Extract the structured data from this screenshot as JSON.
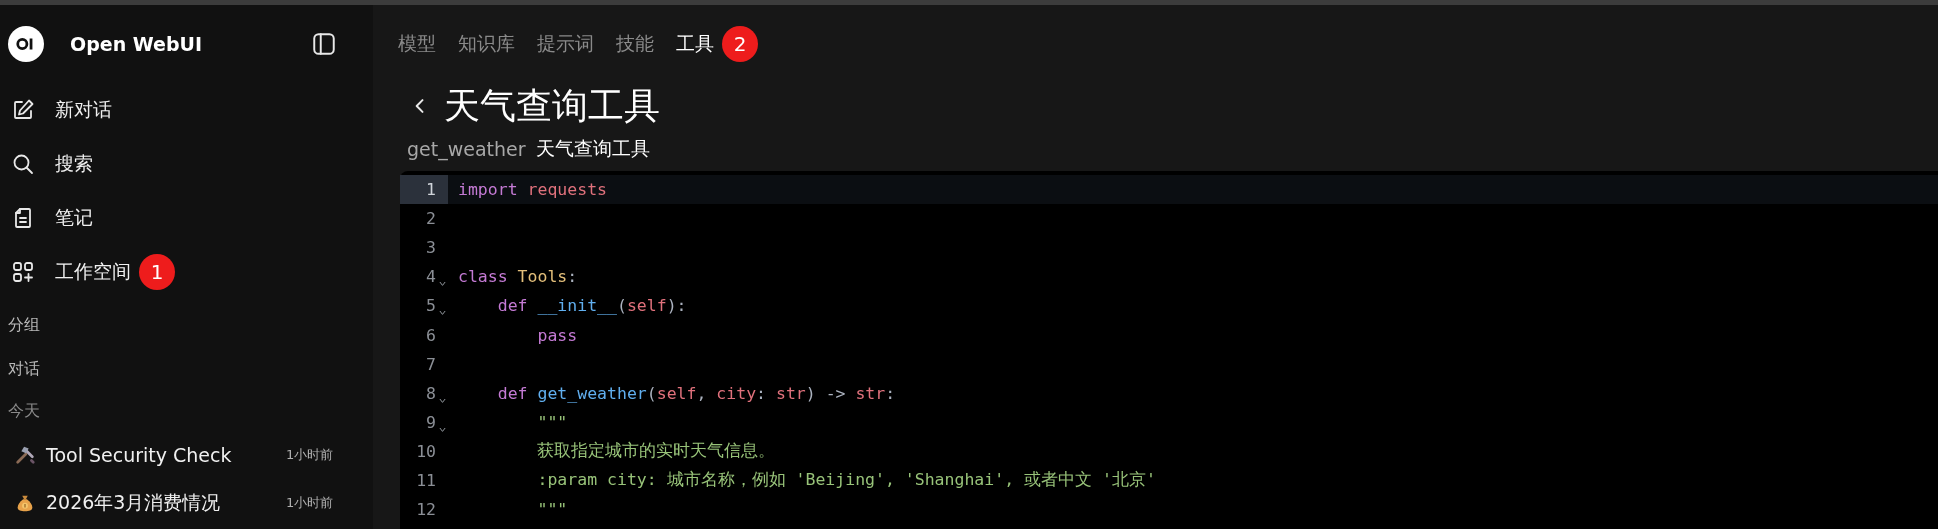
{
  "sidebar": {
    "app_name": "Open WebUI",
    "nav": [
      {
        "label": "新对话",
        "kind": "new-chat"
      },
      {
        "label": "搜索",
        "kind": "search"
      },
      {
        "label": "笔记",
        "kind": "notes"
      },
      {
        "label": "工作空间",
        "kind": "workspace",
        "badge": "1"
      }
    ],
    "groups_label": "分组",
    "chats_label": "对话",
    "chat_groups": [
      {
        "label": "今天",
        "chats": [
          {
            "title": "Tool Security Check",
            "time": "1小时前",
            "kind": "tools"
          },
          {
            "title": "2026年3月消费情况",
            "time": "1小时前",
            "kind": "money"
          }
        ]
      }
    ]
  },
  "tabs": [
    {
      "label": "模型",
      "selected": false
    },
    {
      "label": "知识库",
      "selected": false
    },
    {
      "label": "提示词",
      "selected": false
    },
    {
      "label": "技能",
      "selected": false
    },
    {
      "label": "工具",
      "selected": true,
      "badge": "2"
    }
  ],
  "tool": {
    "title": "天气查询工具",
    "id": "get_weather",
    "name": "天气查询工具"
  },
  "editor": {
    "lines": [
      {
        "number": "1",
        "fold": false,
        "active": true,
        "tokens": [
          {
            "kind": "keyword",
            "text": "import"
          },
          {
            "kind": "module",
            "text": " requests"
          }
        ]
      },
      {
        "number": "2",
        "fold": false,
        "active": false
      },
      {
        "number": "3",
        "fold": false,
        "active": false
      },
      {
        "number": "4",
        "fold": true,
        "active": false,
        "tokens": [
          {
            "kind": "keyword",
            "text": "class"
          },
          {
            "kind": "class",
            "text": " Tools"
          },
          {
            "kind": "punct",
            "text": ":"
          }
        ]
      },
      {
        "number": "5",
        "fold": true,
        "active": false,
        "tokens": [
          {
            "kind": "keyword",
            "text": "    def"
          },
          {
            "kind": "function",
            "text": " __init__"
          },
          {
            "kind": "punct",
            "text": "("
          },
          {
            "kind": "param",
            "text": "self"
          },
          {
            "kind": "punct",
            "text": "):"
          }
        ]
      },
      {
        "number": "6",
        "fold": false,
        "active": false,
        "tokens": [
          {
            "kind": "keyword",
            "text": "        pass"
          }
        ]
      },
      {
        "number": "7",
        "fold": false,
        "active": false
      },
      {
        "number": "8",
        "fold": true,
        "active": false,
        "tokens": [
          {
            "kind": "keyword",
            "text": "    def"
          },
          {
            "kind": "function",
            "text": " get_weather"
          },
          {
            "kind": "punct",
            "text": "("
          },
          {
            "kind": "param",
            "text": "self"
          },
          {
            "kind": "punct",
            "text": ", "
          },
          {
            "kind": "param",
            "text": "city"
          },
          {
            "kind": "punct",
            "text": ": "
          },
          {
            "kind": "param",
            "text": "str"
          },
          {
            "kind": "punct",
            "text": ") -> "
          },
          {
            "kind": "param",
            "text": "str"
          },
          {
            "kind": "punct",
            "text": ":"
          }
        ]
      },
      {
        "number": "9",
        "fold": true,
        "active": false,
        "tokens": [
          {
            "kind": "string",
            "text": "        \"\"\""
          }
        ]
      },
      {
        "number": "10",
        "fold": false,
        "active": false,
        "tokens": [
          {
            "kind": "string",
            "text": "        获取指定城市的实时天气信息。"
          }
        ]
      },
      {
        "number": "11",
        "fold": false,
        "active": false,
        "tokens": [
          {
            "kind": "string",
            "text": "        :param city: 城市名称，例如 'Beijing', 'Shanghai', 或者中文 '北京'"
          }
        ]
      },
      {
        "number": "12",
        "fold": false,
        "active": false,
        "tokens": [
          {
            "kind": "string",
            "text": "        \"\"\""
          }
        ]
      }
    ]
  }
}
